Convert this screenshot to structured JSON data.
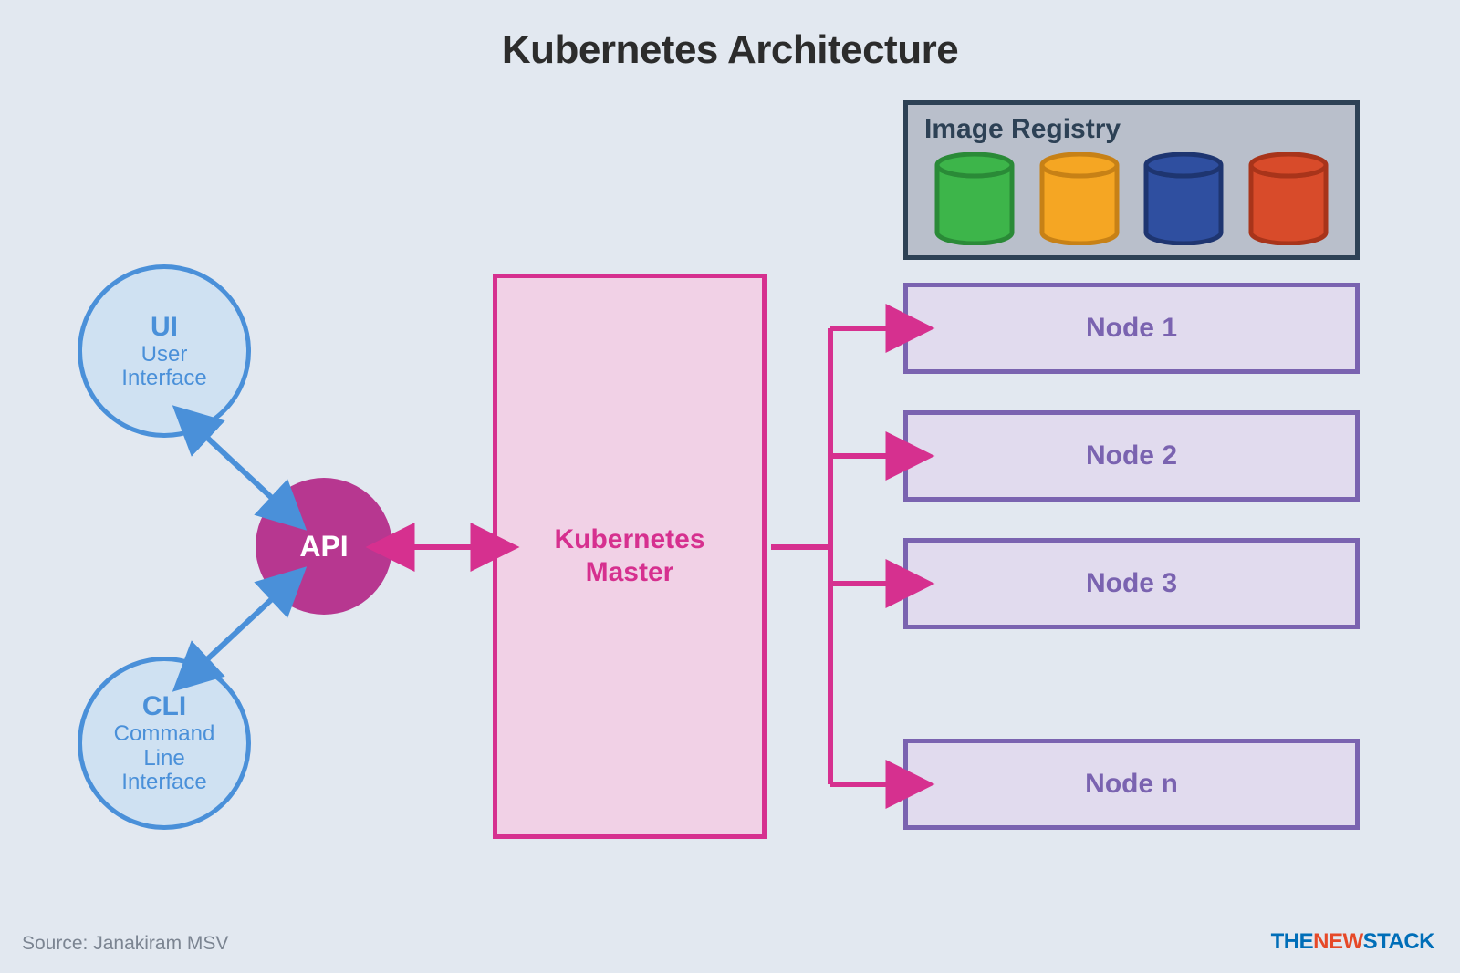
{
  "title": "Kubernetes Architecture",
  "ui": {
    "bold": "UI",
    "line1": "User",
    "line2": "Interface"
  },
  "cli": {
    "bold": "CLI",
    "line1": "Command",
    "line2": "Line",
    "line3": "Interface"
  },
  "api": {
    "label": "API"
  },
  "master": {
    "line1": "Kubernetes",
    "line2": "Master"
  },
  "registry": {
    "title": "Image Registry",
    "cylinders": [
      {
        "fill": "#3db54a",
        "stroke": "#2a8a37"
      },
      {
        "fill": "#f5a623",
        "stroke": "#c78116"
      },
      {
        "fill": "#2f4fa0",
        "stroke": "#1e3570"
      },
      {
        "fill": "#d84b2a",
        "stroke": "#a8341a"
      }
    ]
  },
  "nodes": {
    "n1": "Node 1",
    "n2": "Node 2",
    "n3": "Node 3",
    "nn": "Node n"
  },
  "source": "Source: Janakiram MSV",
  "brand": {
    "the": "THE",
    "new": "NEW",
    "stack": "STACK"
  },
  "colors": {
    "blue": "#4a90d9",
    "magenta": "#d6308f"
  }
}
